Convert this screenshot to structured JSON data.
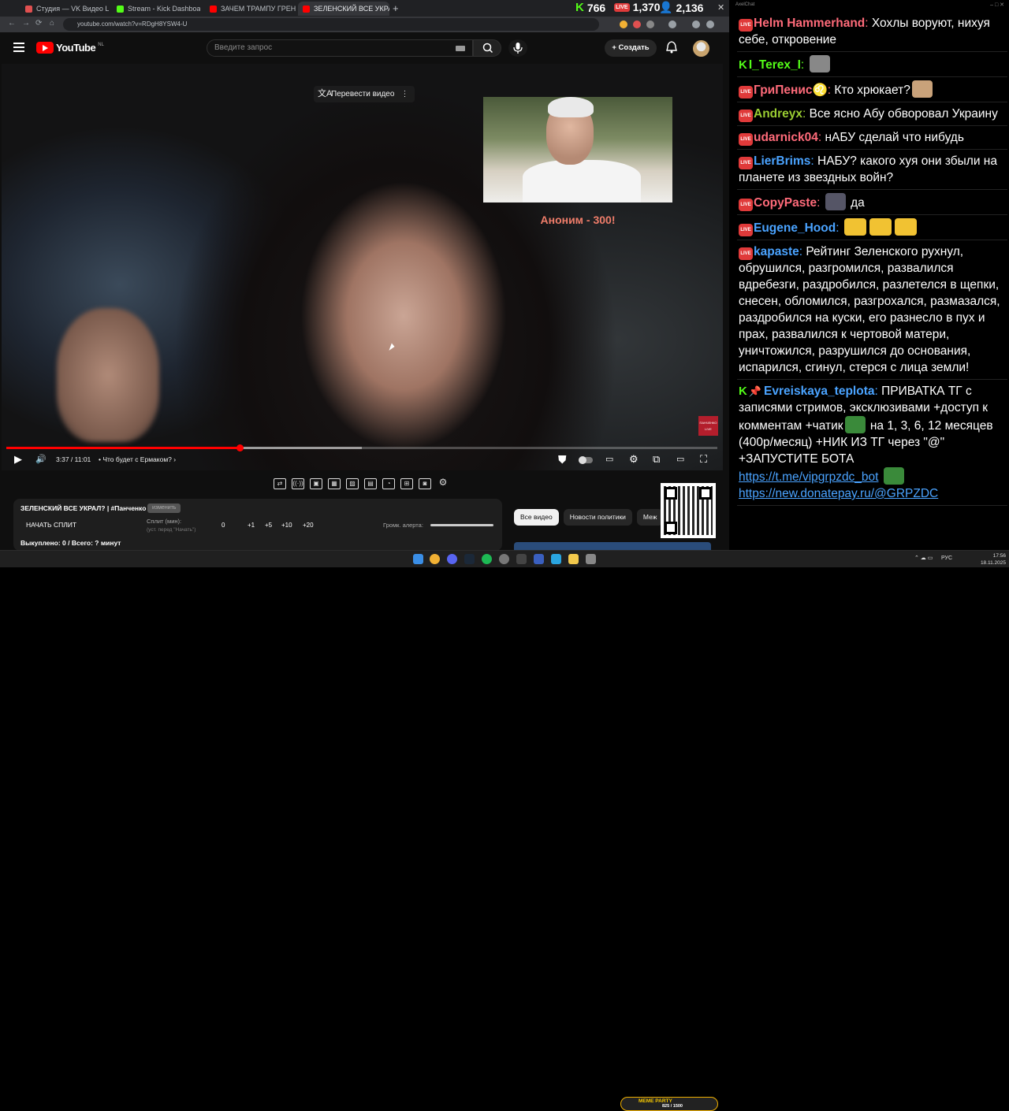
{
  "browser": {
    "tabs": [
      {
        "title": "Студия — VK Видео Live",
        "favicon_color": "#e05050"
      },
      {
        "title": "Stream - Kick Dashboard",
        "favicon_color": "#53fc18"
      },
      {
        "title": "ЗАЧЕМ ТРАМПУ ГРЕНЛАНДИ...",
        "favicon_color": "#ff0000"
      },
      {
        "title": "ЗЕЛЕНСКИЙ ВСЕ УКРАЛ? | #Па...",
        "favicon_color": "#ff0000"
      }
    ],
    "new_tab": "+",
    "tab_close": "×",
    "url": "youtube.com/watch?v=RDgH8YSW4-U",
    "nav": {
      "back": "←",
      "forward": "→",
      "reload": "⟳",
      "home": "⌂"
    },
    "window_controls": {
      "minimize": "–",
      "maximize": "□",
      "close": "✕"
    },
    "stream_stats": {
      "kick_icon": "K",
      "kick_viewers": "766",
      "live_badge": "LIVE",
      "vk_viewers": "1,370",
      "user_icon": "👤",
      "youtube_viewers": "2,136"
    }
  },
  "youtube": {
    "logo_text": "YouTube",
    "region": "NL",
    "search_placeholder": "Введите запрос",
    "search_icon": "⌕",
    "mic_icon": "🎙",
    "create_label": "+ Создать",
    "bell_icon": "🔔",
    "video": {
      "translate_label": "Перевести видео",
      "translate_icon": "文A",
      "more_icon": "⋮",
      "donation_text": "Аноним - 300!",
      "watermark": "ПАНЧЕНКО LIVE",
      "current_time": "3:37",
      "duration": "11:01",
      "time_text": "3:37 / 11:01",
      "chapter": "• Что будет с Ермаком? ›",
      "progress_fraction": 0.328,
      "buffer_fraction": 0.5,
      "controls": {
        "play": "▶",
        "volume": "🔊",
        "autoplay_icon": "⛊",
        "subtitles": "▭",
        "settings": "⚙",
        "miniplayer": "⧉",
        "theater": "▭",
        "fullscreen": "⛶"
      }
    },
    "ext_toolbar": [
      "⇄",
      "((·))",
      "▣",
      "▦",
      "▨",
      "▤",
      "◔",
      "⊞",
      "◙",
      "⚙"
    ],
    "panel": {
      "title": "ЗЕЛЕНСКИЙ ВСЕ УКРАЛ? | #Панченко",
      "badge": "изменить",
      "start_split": "НАЧАТЬ СПЛИТ",
      "split_label": "Сплит (мин):",
      "split_hint": "(уст. перед \"Начать\")",
      "split_values": [
        "0",
        "+1",
        "+5",
        "+10",
        "+20"
      ],
      "volume_label": "Громк. алерта:",
      "paid_text": "Выкуплено: 0 / Всего: ? минут"
    },
    "chips": [
      "Все видео",
      "Новости политики",
      "Меж"
    ],
    "meme_party": {
      "label": "MEME PARTY",
      "count": "825 / 1500"
    }
  },
  "chat": {
    "title": "AxelChat",
    "window_controls": "–  □  ✕",
    "messages": [
      {
        "platform": "vk",
        "nick": "Helm Hammerhand",
        "color": "#ff6b7a",
        "text": "Хохлы воруют, нихуя себе, откровение"
      },
      {
        "platform": "kick",
        "nick": "I_Terex_I",
        "color": "#53fc18",
        "text": "",
        "emote_color": "#888"
      },
      {
        "platform": "vk",
        "nick": "ГриПенис♌",
        "color": "#ff6b7a",
        "text": "Кто хрюкает?",
        "emote_color": "#c9a27a"
      },
      {
        "platform": "vk",
        "nick": "Andreyx",
        "color": "#9acd32",
        "text": "Все ясно Абу обворовал Украину"
      },
      {
        "platform": "vk",
        "nick": "udarnick04",
        "color": "#ff6b7a",
        "text": "нАБУ сделай что нибудь"
      },
      {
        "platform": "vk",
        "nick": "LierBrims",
        "color": "#4aa3ff",
        "text": "НАБУ? какого хуя они збыли на планете из звездных войн?"
      },
      {
        "platform": "vk",
        "nick": "CopyPaste",
        "color": "#ff6b7a",
        "text": "да",
        "emote_color": "#556"
      },
      {
        "platform": "vk",
        "nick": "Eugene_Hood",
        "color": "#4aa3ff",
        "text": "",
        "emote_color": "#f1c232"
      },
      {
        "platform": "vk",
        "nick": "kapaste",
        "color": "#4aa3ff",
        "text": "Рейтинг Зеленского рухнул, обрушился, разгромился, развалился вдребезги, раздробился, разлетелся в щепки, снесен, обломился, разгрохался, размазался, раздробился на куски, его разнесло в пух и прах, развалился к чертовой матери, уничтожился, разрушился до основания, испарился, сгинул, стерся с лица земли!"
      },
      {
        "platform": "kick",
        "nick": "Evreiskaya_teplota",
        "color": "#4aa3ff",
        "pin": "📌",
        "text": "ПРИВАТКА ТГ с записями стримов, эксклюзивами +доступ к комментам +чатик",
        "text2": "на 1, 3, 6, 12 месяцев (400р/месяц) +НИК ИЗ ТГ через \"@\" +ЗАПУСТИТЕ БОТА",
        "emote_color": "#3a8a3a",
        "link1": "https://t.me/vipgrpzdc_bot",
        "link2": "https://new.donatepay.ru/@GRPZDC"
      }
    ]
  },
  "taskbar": {
    "lang": "РУС",
    "time": "17:56",
    "date": "18.11.2025",
    "tray": "⌃  ☁  ▭"
  }
}
